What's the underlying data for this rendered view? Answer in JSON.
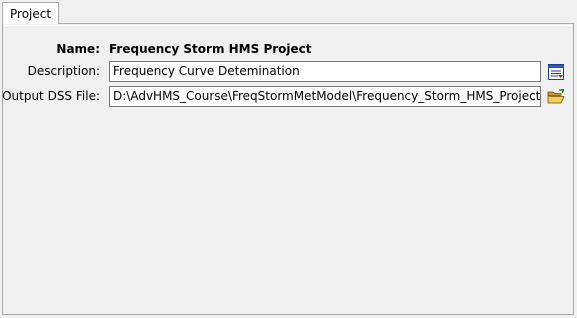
{
  "tabs": [
    {
      "label": "Project",
      "selected": true
    }
  ],
  "form": {
    "name": {
      "label": "Name:",
      "value": "Frequency Storm HMS Project"
    },
    "description": {
      "label": "Description:",
      "value": "Frequency Curve Detemination",
      "button_icon": "description-editor-icon"
    },
    "output_dss": {
      "label": "Output DSS File:",
      "value": "D:\\AdvHMS_Course\\FreqStormMetModel\\Frequency_Storm_HMS_Project\\",
      "button_icon": "folder-open-icon"
    }
  }
}
